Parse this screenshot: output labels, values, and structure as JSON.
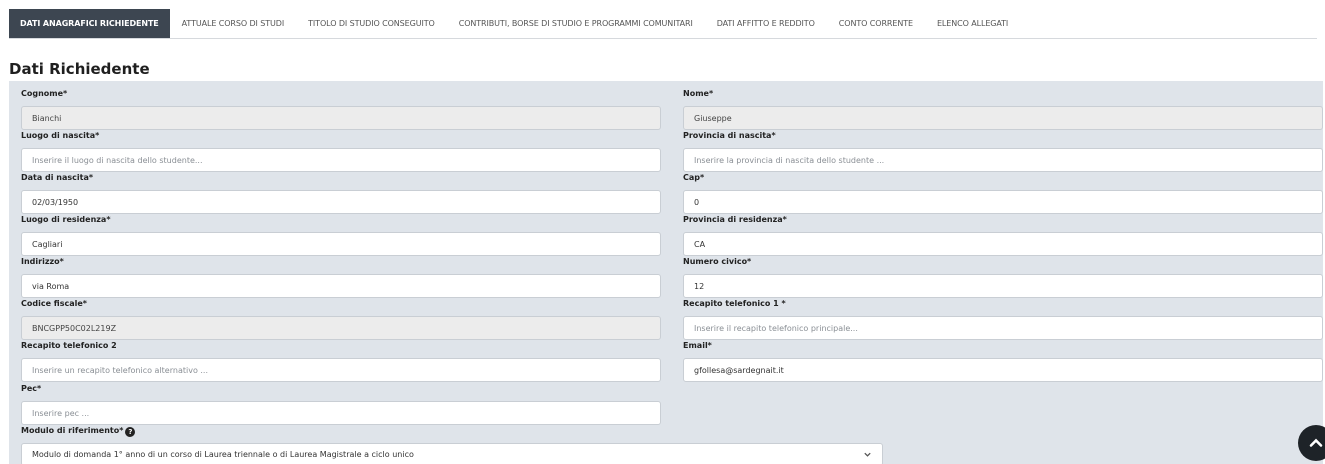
{
  "tabs": [
    {
      "label": "DATI ANAGRAFICI RICHIEDENTE",
      "active": true
    },
    {
      "label": "ATTUALE CORSO DI STUDI"
    },
    {
      "label": "TITOLO DI STUDIO CONSEGUITO"
    },
    {
      "label": "CONTRIBUTI, BORSE DI STUDIO E PROGRAMMI COMUNITARI"
    },
    {
      "label": "DATI AFFITTO E REDDITO"
    },
    {
      "label": "CONTO CORRENTE"
    },
    {
      "label": "ELENCO ALLEGATI"
    }
  ],
  "section_title": "Dati Richiedente",
  "form": {
    "cognome": {
      "label": "Cognome*",
      "value": "Bianchi"
    },
    "nome": {
      "label": "Nome*",
      "value": "Giuseppe"
    },
    "luogo_nascita": {
      "label": "Luogo di nascita*",
      "placeholder": "Inserire il luogo di nascita dello studente..."
    },
    "provincia_nascita": {
      "label": "Provincia di nascita*",
      "placeholder": "Inserire la provincia di nascita dello studente ..."
    },
    "data_nascita": {
      "label": "Data di nascita*",
      "value": "02/03/1950"
    },
    "cap": {
      "label": "Cap*",
      "value": "0"
    },
    "luogo_residenza": {
      "label": "Luogo di residenza*",
      "value": "Cagliari"
    },
    "provincia_residenza": {
      "label": "Provincia di residenza*",
      "value": "CA"
    },
    "indirizzo": {
      "label": "Indirizzo*",
      "value": "via Roma"
    },
    "numero_civico": {
      "label": "Numero civico*",
      "value": "12"
    },
    "codice_fiscale": {
      "label": "Codice fiscale*",
      "value": "BNCGPP50C02L219Z"
    },
    "recapito1": {
      "label": "Recapito telefonico 1 *",
      "placeholder": "Inserire il recapito telefonico principale..."
    },
    "recapito2": {
      "label": "Recapito telefonico 2",
      "placeholder": "Inserire un recapito telefonico alternativo ..."
    },
    "email": {
      "label": "Email*",
      "value": "gfollesa@sardegnait.it"
    },
    "pec": {
      "label": "Pec*",
      "placeholder": "Inserire pec ..."
    },
    "modulo": {
      "label": "Modulo di riferimento*",
      "value": "Modulo di domanda 1° anno di un corso di Laurea triennale o di Laurea Magistrale a ciclo unico"
    }
  },
  "icons": {
    "help": "question-circle-icon",
    "chevron": "chevron-down-icon",
    "scroll_top": "chevron-up-icon"
  },
  "colors": {
    "active_tab": "#3d4651",
    "panel": "#dfe4ea",
    "readonly_field": "#ececec"
  }
}
